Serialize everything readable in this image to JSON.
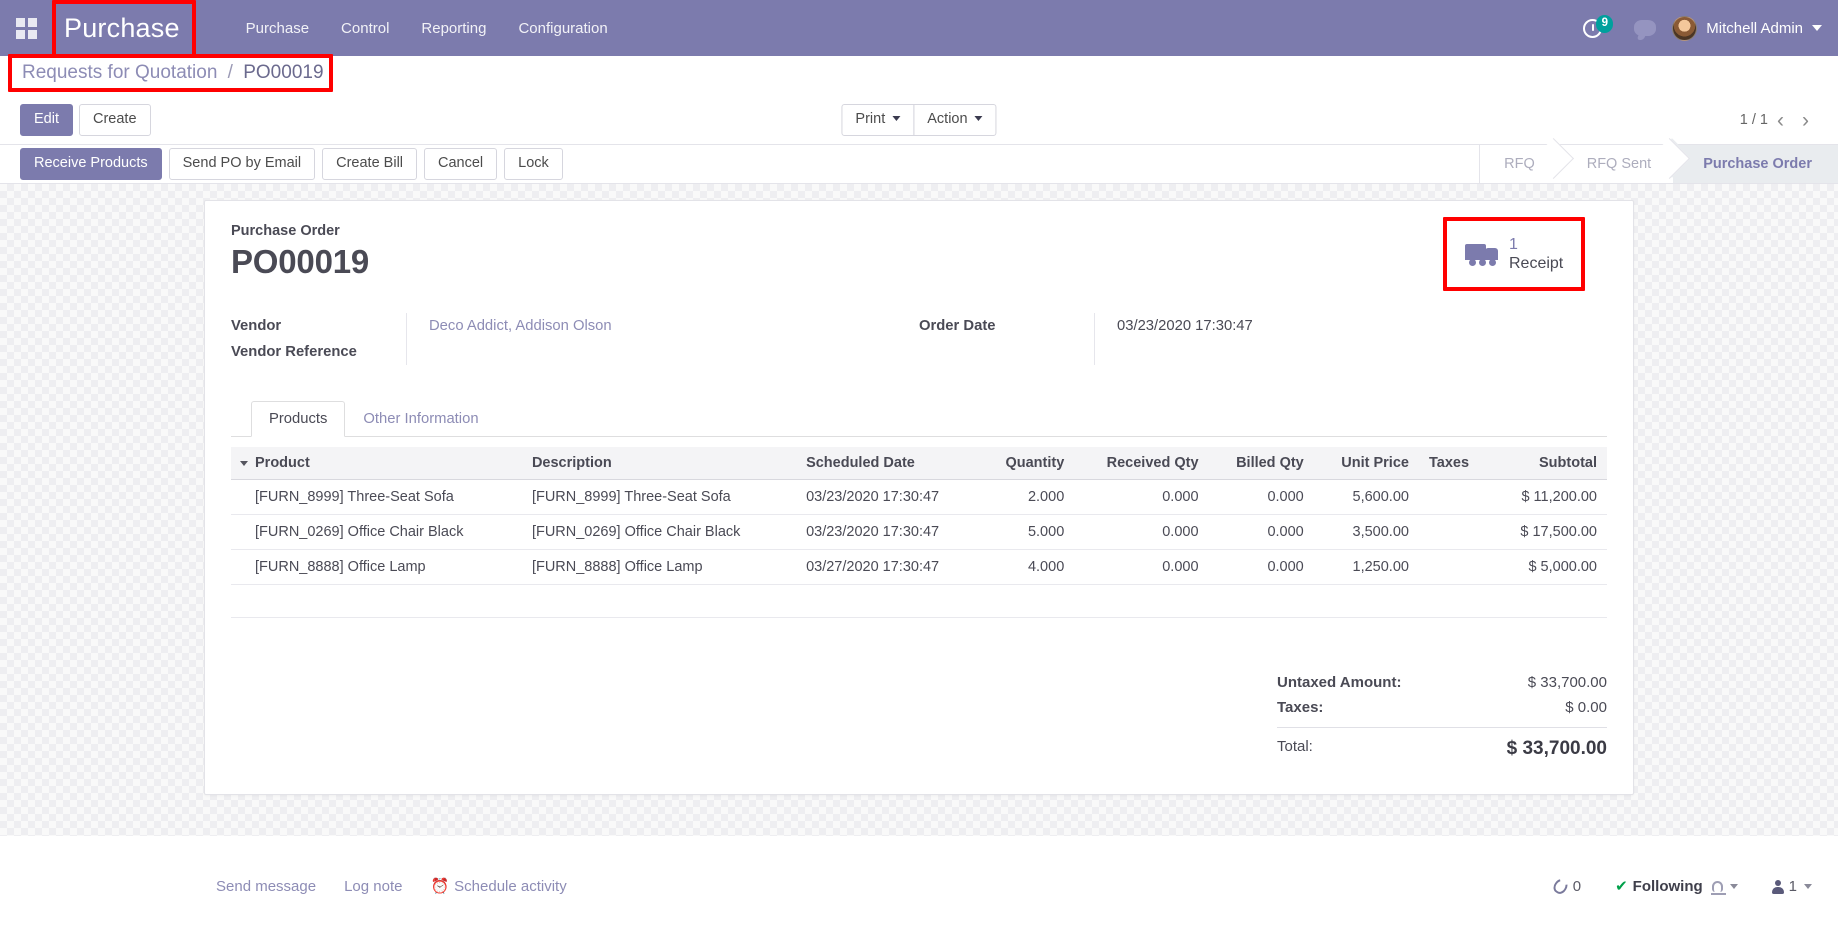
{
  "navbar": {
    "apps_icon": "apps-grid-icon",
    "brand": "Purchase",
    "menu": [
      {
        "label": "Purchase"
      },
      {
        "label": "Control"
      },
      {
        "label": "Reporting"
      },
      {
        "label": "Configuration"
      }
    ],
    "activity_icon": "clock-icon",
    "activity_count": "9",
    "messages_icon": "chat-bubble-icon",
    "user_name": "Mitchell Admin",
    "user_caret": "chevron-down-icon",
    "brand_color": "#7C7BAD",
    "badge_color": "#00A09D"
  },
  "breadcrumb": {
    "parent": "Requests for Quotation",
    "separator": "/",
    "current": "PO00019",
    "highlight_color": "#FF0000"
  },
  "control_panel": {
    "edit_label": "Edit",
    "create_label": "Create",
    "print_label": "Print",
    "action_label": "Action",
    "pager_value": "1 / 1",
    "prev_icon": "chevron-left-icon",
    "next_icon": "chevron-right-icon"
  },
  "statusbar": {
    "buttons": [
      {
        "label": "Receive Products",
        "primary": true
      },
      {
        "label": "Send PO by Email",
        "primary": false
      },
      {
        "label": "Create Bill",
        "primary": false
      },
      {
        "label": "Cancel",
        "primary": false
      },
      {
        "label": "Lock",
        "primary": false
      }
    ],
    "stages": [
      {
        "label": "RFQ",
        "active": false
      },
      {
        "label": "RFQ Sent",
        "active": false
      },
      {
        "label": "Purchase Order",
        "active": true
      }
    ]
  },
  "sheet": {
    "header_label": "Purchase Order",
    "title": "PO00019",
    "stat_button": {
      "icon": "truck-icon",
      "value": "1",
      "label": "Receipt"
    },
    "fields_left": [
      {
        "label": "Vendor",
        "value": "Deco Addict, Addison Olson",
        "is_link": true
      },
      {
        "label": "Vendor Reference",
        "value": "",
        "is_link": false
      }
    ],
    "fields_right": [
      {
        "label": "Order Date",
        "value": "03/23/2020 17:30:47",
        "is_link": false
      }
    ],
    "tabs": [
      {
        "label": "Products",
        "active": true
      },
      {
        "label": "Other Information",
        "active": false
      }
    ],
    "table": {
      "sort_icon": "sort-caret-icon",
      "columns": [
        "Product",
        "Description",
        "Scheduled Date",
        "Quantity",
        "Received Qty",
        "Billed Qty",
        "Unit Price",
        "Taxes",
        "Subtotal"
      ],
      "rows": [
        {
          "product": "[FURN_8999] Three-Seat Sofa",
          "description": "[FURN_8999] Three-Seat Sofa",
          "scheduled_date": "03/23/2020 17:30:47",
          "quantity": "2.000",
          "received_qty": "0.000",
          "billed_qty": "0.000",
          "unit_price": "5,600.00",
          "taxes": "",
          "subtotal": "$ 11,200.00"
        },
        {
          "product": "[FURN_0269] Office Chair Black",
          "description": "[FURN_0269] Office Chair Black",
          "scheduled_date": "03/23/2020 17:30:47",
          "quantity": "5.000",
          "received_qty": "0.000",
          "billed_qty": "0.000",
          "unit_price": "3,500.00",
          "taxes": "",
          "subtotal": "$ 17,500.00"
        },
        {
          "product": "[FURN_8888] Office Lamp",
          "description": "[FURN_8888] Office Lamp",
          "scheduled_date": "03/27/2020 17:30:47",
          "quantity": "4.000",
          "received_qty": "0.000",
          "billed_qty": "0.000",
          "unit_price": "1,250.00",
          "taxes": "",
          "subtotal": "$ 5,000.00"
        }
      ]
    },
    "totals": {
      "untaxed_label": "Untaxed Amount:",
      "untaxed_value": "$ 33,700.00",
      "taxes_label": "Taxes:",
      "taxes_value": "$ 0.00",
      "total_label": "Total:",
      "total_value": "$ 33,700.00"
    }
  },
  "chatter": {
    "send_message": "Send message",
    "log_note": "Log note",
    "schedule_activity": "Schedule activity",
    "schedule_icon": "clock-icon",
    "attachment_icon": "paperclip-icon",
    "attachment_count": "0",
    "following_icon": "check-icon",
    "following_label": "Following",
    "bell_icon": "bell-icon",
    "followers_icon": "person-icon",
    "followers_count": "1"
  }
}
